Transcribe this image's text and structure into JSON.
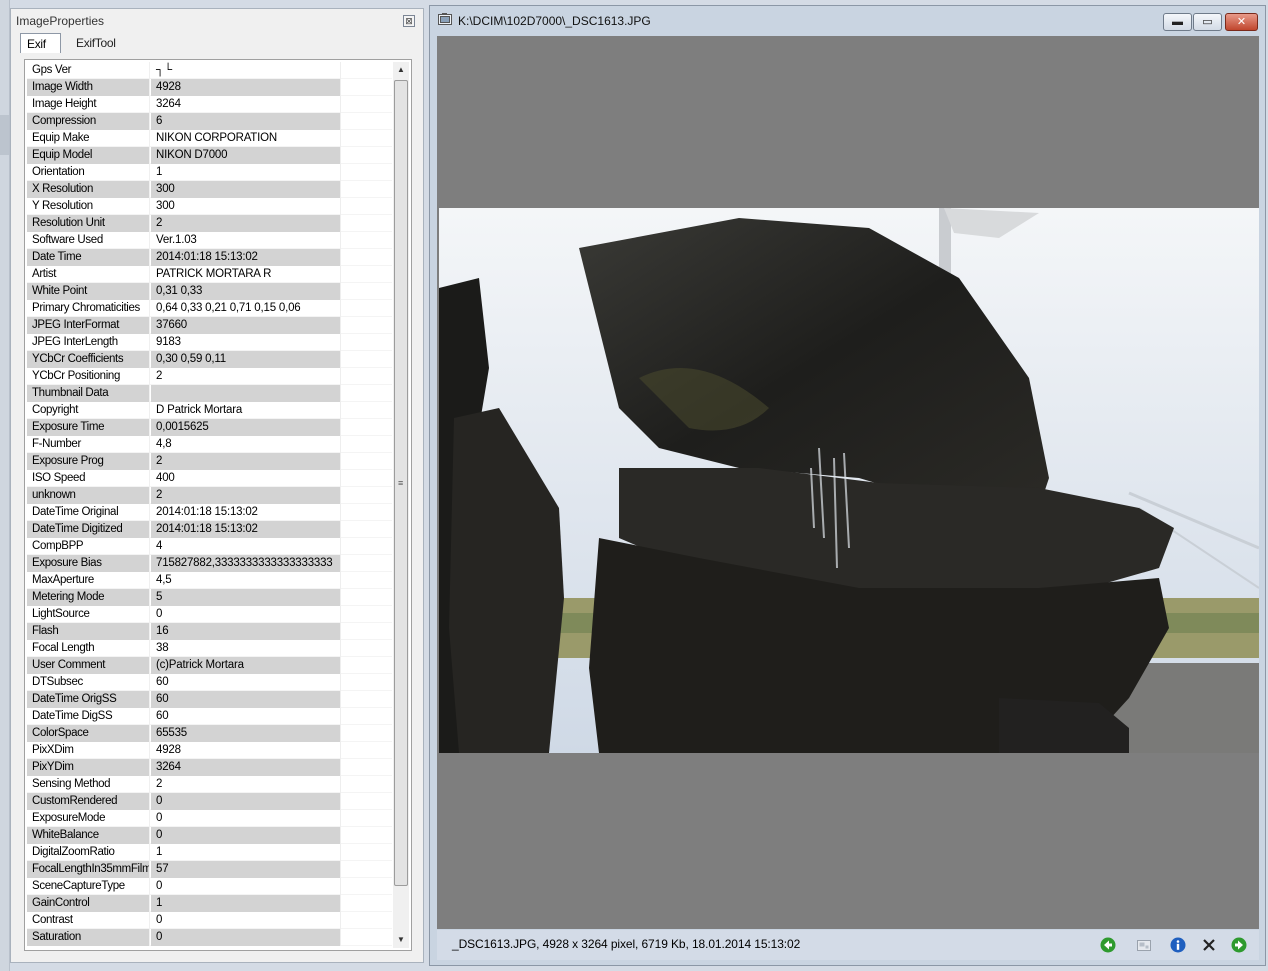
{
  "panel": {
    "title": "ImageProperties",
    "close_glyph": "⊠",
    "tabs": [
      {
        "label": "Exif",
        "active": true
      },
      {
        "label": "ExifTool",
        "active": false
      }
    ]
  },
  "exif_rows": [
    {
      "name": "Gps Ver",
      "value": "┐└"
    },
    {
      "name": "Image Width",
      "value": "4928"
    },
    {
      "name": "Image Height",
      "value": "3264"
    },
    {
      "name": "Compression",
      "value": "6"
    },
    {
      "name": "Equip Make",
      "value": "NIKON CORPORATION"
    },
    {
      "name": "Equip Model",
      "value": "NIKON D7000"
    },
    {
      "name": "Orientation",
      "value": "1"
    },
    {
      "name": "X Resolution",
      "value": "300"
    },
    {
      "name": "Y Resolution",
      "value": "300"
    },
    {
      "name": "Resolution Unit",
      "value": "2"
    },
    {
      "name": "Software Used",
      "value": "Ver.1.03"
    },
    {
      "name": "Date Time",
      "value": "2014:01:18 15:13:02"
    },
    {
      "name": "Artist",
      "value": "PATRICK MORTARA      R"
    },
    {
      "name": "White Point",
      "value": "0,31 0,33"
    },
    {
      "name": "Primary Chromaticities",
      "value": "0,64 0,33 0,21 0,71 0,15 0,06"
    },
    {
      "name": "JPEG InterFormat",
      "value": "37660"
    },
    {
      "name": "JPEG InterLength",
      "value": "9183"
    },
    {
      "name": "YCbCr Coefficients",
      "value": "0,30 0,59 0,11"
    },
    {
      "name": "YCbCr Positioning",
      "value": "2"
    },
    {
      "name": "Thumbnail Data",
      "value": ""
    },
    {
      "name": "Copyright",
      "value": "D  Patrick Mortara"
    },
    {
      "name": "Exposure Time",
      "value": "0,0015625"
    },
    {
      "name": "F-Number",
      "value": "4,8"
    },
    {
      "name": "Exposure Prog",
      "value": "2"
    },
    {
      "name": "ISO Speed",
      "value": "400"
    },
    {
      "name": "unknown",
      "value": "2"
    },
    {
      "name": "DateTime Original",
      "value": "2014:01:18 15:13:02"
    },
    {
      "name": "DateTime Digitized",
      "value": "2014:01:18 15:13:02"
    },
    {
      "name": "CompBPP",
      "value": "4"
    },
    {
      "name": "Exposure Bias",
      "value": "715827882,3333333333333333333"
    },
    {
      "name": "MaxAperture",
      "value": "4,5"
    },
    {
      "name": "Metering Mode",
      "value": "5"
    },
    {
      "name": "LightSource",
      "value": "0"
    },
    {
      "name": "Flash",
      "value": "16"
    },
    {
      "name": "Focal Length",
      "value": "38"
    },
    {
      "name": "User Comment",
      "value": "(c)Patrick Mortara"
    },
    {
      "name": "DTSubsec",
      "value": "60"
    },
    {
      "name": "DateTime OrigSS",
      "value": "60"
    },
    {
      "name": "DateTime DigSS",
      "value": "60"
    },
    {
      "name": "ColorSpace",
      "value": "65535"
    },
    {
      "name": "PixXDim",
      "value": "4928"
    },
    {
      "name": "PixYDim",
      "value": "3264"
    },
    {
      "name": "Sensing Method",
      "value": "2"
    },
    {
      "name": "CustomRendered",
      "value": "0"
    },
    {
      "name": "ExposureMode",
      "value": "0"
    },
    {
      "name": "WhiteBalance",
      "value": "0"
    },
    {
      "name": "DigitalZoomRatio",
      "value": "1"
    },
    {
      "name": "FocalLengthIn35mmFilm",
      "value": "57"
    },
    {
      "name": "SceneCaptureType",
      "value": "0"
    },
    {
      "name": "GainControl",
      "value": "1"
    },
    {
      "name": "Contrast",
      "value": "0"
    },
    {
      "name": "Saturation",
      "value": "0"
    }
  ],
  "scrollbar": {
    "up_glyph": "▲",
    "down_glyph": "▼",
    "grip_glyph": "≡"
  },
  "viewer": {
    "title": "K:\\DCIM\\102D7000\\_DSC1613.JPG",
    "minimize_glyph": "▬",
    "maximize_glyph": "▭",
    "close_glyph": "✕",
    "status": "_DSC1613.JPG,  4928 x 3264 pixel,  6719 Kb,  18.01.2014  15:13:02",
    "status_icons": [
      "arrow-left-icon",
      "thumbnail-icon",
      "info-icon",
      "delete-icon",
      "arrow-right-icon"
    ]
  },
  "colors": {
    "viewer_background": "#7e7e7e",
    "row_stripe": "#d3d3d3",
    "nav_green": "#2e9a2e",
    "info_blue": "#1f5fbf"
  }
}
